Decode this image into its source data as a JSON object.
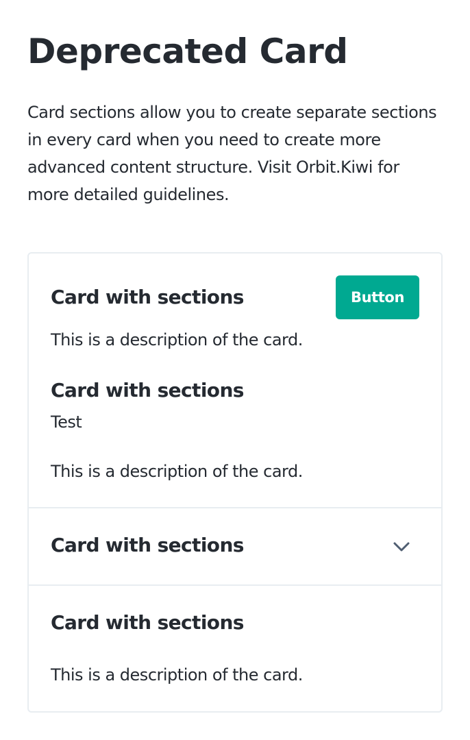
{
  "page": {
    "title": "Deprecated Card",
    "intro": "Card sections allow you to create separate sections in every card when you need to create more advanced content structure. Visit Orbit.Kiwi for more detailed guidelines."
  },
  "card": {
    "header": {
      "title": "Card with sections",
      "description": "This is a description of the card.",
      "button_label": "Button"
    },
    "section_first": {
      "title": "Card with sections",
      "subtitle": "Test",
      "description": "This is a description of the card."
    },
    "section_expandable": {
      "title": "Card with sections",
      "icon": "chevron-down-icon"
    },
    "section_last": {
      "title": "Card with sections",
      "description": "This is a description of the card."
    }
  },
  "colors": {
    "accent": "#00a991",
    "text": "#252a31",
    "border": "#e8edf1",
    "icon": "#4f5e71"
  }
}
